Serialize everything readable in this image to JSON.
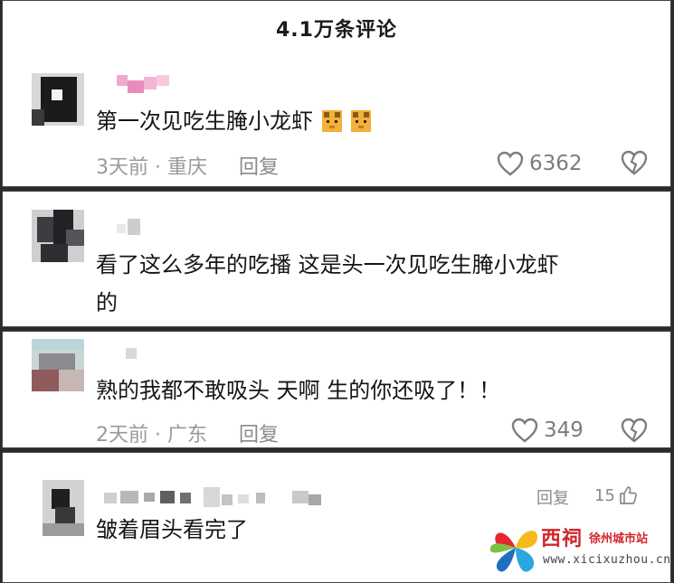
{
  "header": {
    "title": "4.1万条评论"
  },
  "comments": [
    {
      "text": "第一次见吃生腌小龙虾",
      "emoji": [
        "cat-face-icon",
        "cat-face-icon"
      ],
      "time_location": "3天前 · 重庆",
      "reply_label": "回复",
      "likes": "6362"
    },
    {
      "text_line1": "看了这么多年的吃播 这是头一次见吃生腌小龙虾",
      "text_line2": "的"
    },
    {
      "text": "熟的我都不敢吸头  天啊 生的你还吸了！！",
      "time_location": "2天前 · 广东",
      "reply_label": "回复",
      "likes": "349"
    },
    {
      "text": "皱着眉头看完了",
      "reply_label": "回复",
      "likes": "15"
    }
  ],
  "watermark": {
    "name": "西祠",
    "sub": "徐州城市站",
    "url": "www.xicixuzhou.cn"
  },
  "colors": {
    "text": "#151515",
    "meta": "#9a9a9a",
    "brand_red": "#d0262d"
  }
}
